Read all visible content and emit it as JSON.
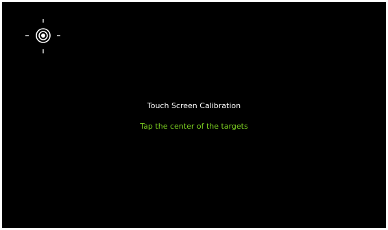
{
  "calibration": {
    "title": "Touch Screen Calibration",
    "instruction": "Tap the center of the targets",
    "target_icon": "crosshair-target-icon"
  },
  "colors": {
    "background": "#000000",
    "title_text": "#ffffff",
    "instruction_text": "#7ed321",
    "target": "#ffffff"
  }
}
